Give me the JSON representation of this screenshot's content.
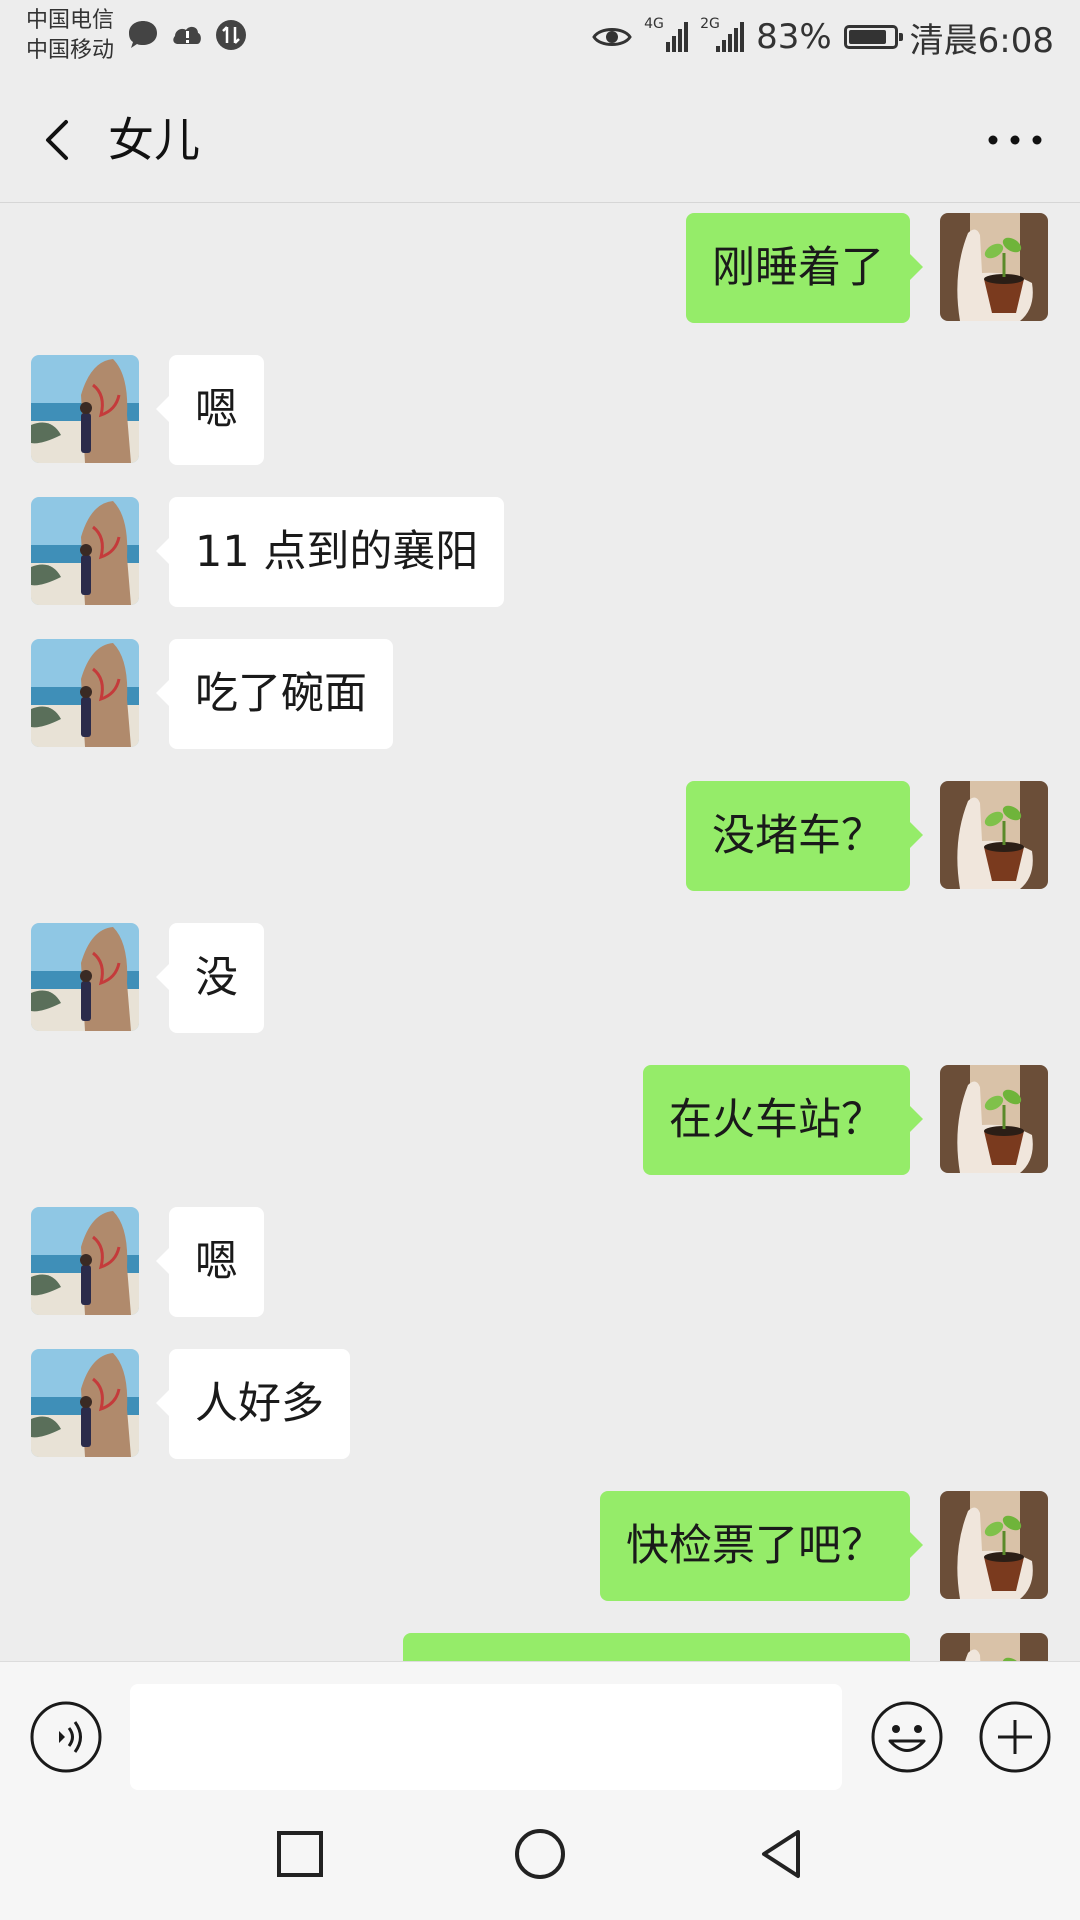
{
  "status_bar": {
    "carrier_1": "中国电信",
    "carrier_2": "中国移动",
    "network_1": "4G",
    "network_2": "2G",
    "battery": "83%",
    "battery_level": 0.83,
    "time": "清晨6:08",
    "icons": [
      "message-icon",
      "cloud-alert-icon",
      "data-sync-icon",
      "eye-icon",
      "signal-icon",
      "battery-icon"
    ]
  },
  "header": {
    "title": "女儿",
    "icons": [
      "back-arrow-icon",
      "more-icon"
    ]
  },
  "messages": [
    {
      "side": "out",
      "text": "刚睡着了"
    },
    {
      "side": "in",
      "text": "嗯"
    },
    {
      "side": "in",
      "text": "11 点到的襄阳"
    },
    {
      "side": "in",
      "text": "吃了碗面"
    },
    {
      "side": "out",
      "text": "没堵车？"
    },
    {
      "side": "in",
      "text": "没"
    },
    {
      "side": "out",
      "text": "在火车站？"
    },
    {
      "side": "in",
      "text": "嗯"
    },
    {
      "side": "in",
      "text": "人好多"
    },
    {
      "side": "out",
      "text": "快检票了吧？"
    },
    {
      "side": "out",
      "text": ""
    }
  ],
  "input": {
    "value": "",
    "placeholder": "",
    "icons": [
      "voice-icon",
      "emoji-icon",
      "plus-icon"
    ]
  },
  "nav": {
    "icons": [
      "recent-apps-icon",
      "home-icon",
      "back-icon"
    ]
  },
  "colors": {
    "background": "#ededed",
    "outgoing_bubble": "#95ec69",
    "incoming_bubble": "#ffffff"
  }
}
